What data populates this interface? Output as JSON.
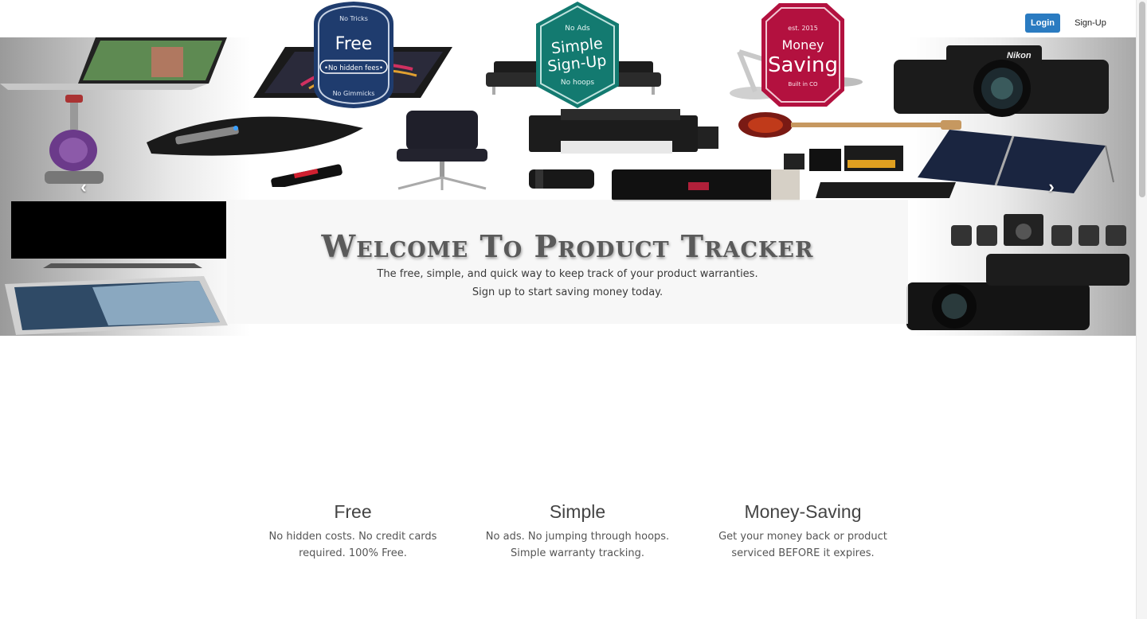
{
  "nav": {
    "login_label": "Login",
    "signup_label": "Sign-Up"
  },
  "hero": {
    "title": "Welcome To Product Tracker",
    "subtitle_line1": "The free, simple, and quick way to keep track of your product warranties.",
    "subtitle_line2": "Sign up to start saving money today.",
    "prev_icon": "chevron-left-icon",
    "next_icon": "chevron-right-icon",
    "products": [
      "laptop",
      "tablet",
      "sofa",
      "desk-lamp",
      "camera",
      "vacuum",
      "mouse",
      "office-chair",
      "printer",
      "guitar",
      "sd-cards",
      "solar-panel",
      "usb-drive",
      "lens",
      "3d-printer",
      "keyboard",
      "tv",
      "speakers",
      "tablet-small",
      "camcorder"
    ],
    "camera_brand": "Nikon"
  },
  "features": [
    {
      "badge": {
        "top": "No Tricks",
        "main": "Free",
        "ribbon": "•No hidden fees•",
        "bottom": "No Gimmicks",
        "color": "#1f3c6e"
      },
      "title": "Free",
      "line1": "No hidden costs. No credit cards",
      "line2": "required. 100% Free."
    },
    {
      "badge": {
        "top": "No Ads",
        "main1": "Simple",
        "main2": "Sign-Up",
        "bottom": "No hoops",
        "color": "#137a70"
      },
      "title": "Simple",
      "line1": "No ads. No jumping through hoops.",
      "line2": "Simple warranty tracking."
    },
    {
      "badge": {
        "top": "est. 2015",
        "main1": "Money",
        "main2": "Saving",
        "bottom": "Built in CO",
        "color": "#b3113f"
      },
      "title": "Money-Saving",
      "line1": "Get your money back or product",
      "line2": "serviced BEFORE it expires."
    }
  ]
}
